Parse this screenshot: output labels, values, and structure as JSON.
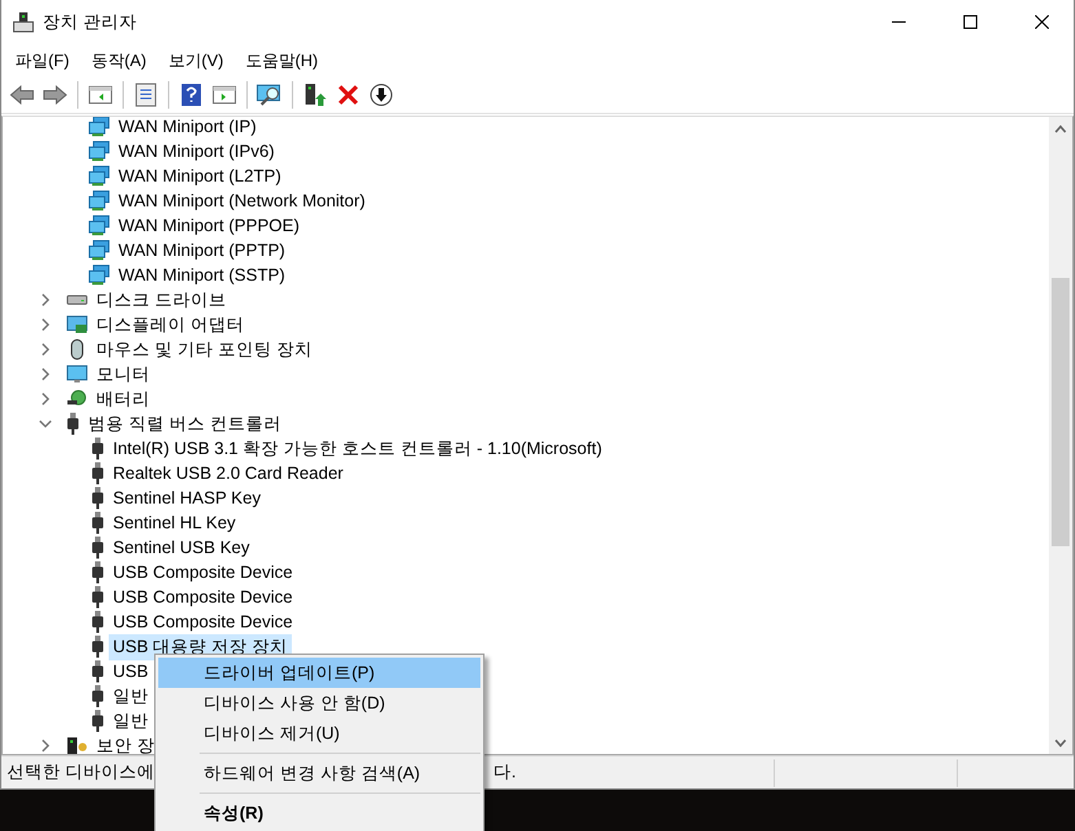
{
  "window": {
    "title": "장치 관리자"
  },
  "menu_bar": [
    "파일(F)",
    "동작(A)",
    "보기(V)",
    "도움말(H)"
  ],
  "toolbar": [
    {
      "kind": "back"
    },
    {
      "kind": "forward"
    },
    {
      "kind": "sep"
    },
    {
      "kind": "tree"
    },
    {
      "kind": "sep"
    },
    {
      "kind": "props"
    },
    {
      "kind": "sep"
    },
    {
      "kind": "help"
    },
    {
      "kind": "pane"
    },
    {
      "kind": "sep"
    },
    {
      "kind": "scan"
    },
    {
      "kind": "sep"
    },
    {
      "kind": "update"
    },
    {
      "kind": "remove"
    },
    {
      "kind": "download"
    }
  ],
  "tree": {
    "continued_children": [
      {
        "label": "WAN Miniport (IP)",
        "kind": "network",
        "selected": false
      },
      {
        "label": "WAN Miniport (IPv6)",
        "kind": "network",
        "selected": false
      },
      {
        "label": "WAN Miniport (L2TP)",
        "kind": "network",
        "selected": false
      },
      {
        "label": "WAN Miniport (Network Monitor)",
        "kind": "network",
        "selected": false
      },
      {
        "label": "WAN Miniport (PPPOE)",
        "kind": "network",
        "selected": false
      },
      {
        "label": "WAN Miniport (PPTP)",
        "kind": "network",
        "selected": false
      },
      {
        "label": "WAN Miniport (SSTP)",
        "kind": "network",
        "selected": false
      }
    ],
    "nodes": [
      {
        "label": "디스크 드라이브",
        "kind": "disk",
        "expanded": false,
        "selected": false
      },
      {
        "label": "디스플레이 어댑터",
        "kind": "display",
        "expanded": false,
        "selected": false
      },
      {
        "label": "마우스 및 기타 포인팅 장치",
        "kind": "mouse",
        "expanded": false,
        "selected": false
      },
      {
        "label": "모니터",
        "kind": "monitor",
        "expanded": false,
        "selected": false
      },
      {
        "label": "배터리",
        "kind": "battery",
        "expanded": false,
        "selected": false
      },
      {
        "label": "범용 직렬 버스 컨트롤러",
        "kind": "usb",
        "expanded": true,
        "selected": false,
        "children": [
          {
            "label": "Intel(R) USB 3.1 확장 가능한 호스트 컨트롤러 - 1.10(Microsoft)",
            "kind": "usb",
            "selected": false
          },
          {
            "label": "Realtek USB 2.0 Card Reader",
            "kind": "usb",
            "selected": false
          },
          {
            "label": "Sentinel HASP Key",
            "kind": "usb",
            "selected": false
          },
          {
            "label": "Sentinel HL Key",
            "kind": "usb",
            "selected": false
          },
          {
            "label": "Sentinel USB Key",
            "kind": "usb",
            "selected": false
          },
          {
            "label": "USB Composite Device",
            "kind": "usb",
            "selected": false
          },
          {
            "label": "USB Composite Device",
            "kind": "usb",
            "selected": false
          },
          {
            "label": "USB Composite Device",
            "kind": "usb",
            "selected": false
          },
          {
            "label": "USB 대용량 저장 장치",
            "kind": "usb",
            "selected": true
          },
          {
            "label": "USB",
            "kind": "usb",
            "selected": false
          },
          {
            "label": "일반",
            "kind": "usb",
            "selected": false
          },
          {
            "label": "일반",
            "kind": "usb",
            "selected": false
          }
        ]
      },
      {
        "label": "보안 장",
        "kind": "security",
        "expanded": false,
        "selected": false
      }
    ]
  },
  "status_bar": {
    "text_start": "선택한 디바이스에",
    "text_end": "다."
  },
  "context_menu": [
    {
      "kind": "item",
      "label": "드라이버 업데이트(P)",
      "selected": true,
      "default": false
    },
    {
      "kind": "item",
      "label": "디바이스 사용 안 함(D)",
      "selected": false,
      "default": false
    },
    {
      "kind": "item",
      "label": "디바이스 제거(U)",
      "selected": false,
      "default": false
    },
    {
      "kind": "separator"
    },
    {
      "kind": "item",
      "label": "하드웨어 변경 사항 검색(A)",
      "selected": false,
      "default": false
    },
    {
      "kind": "separator"
    },
    {
      "kind": "item",
      "label": "속성(R)",
      "selected": false,
      "default": true
    }
  ]
}
